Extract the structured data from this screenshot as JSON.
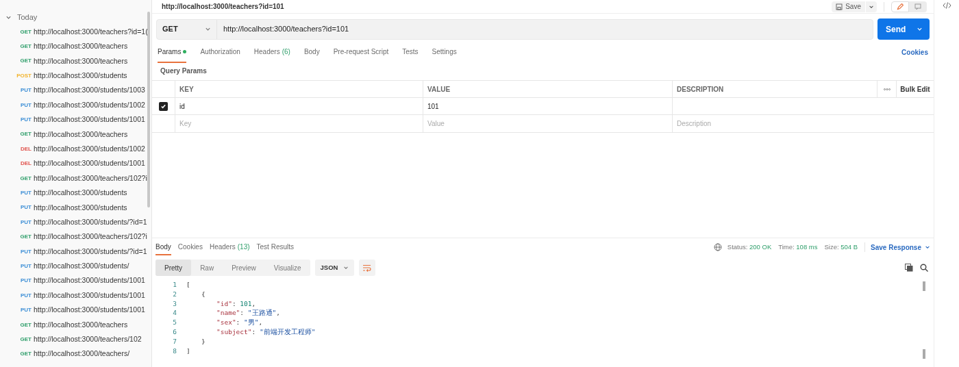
{
  "sidebar": {
    "group": {
      "label": "Today",
      "expanded": true
    },
    "items": [
      {
        "method": "GET",
        "color": "#2e9e6a",
        "url": "http://localhost:3000/teachers?id=1("
      },
      {
        "method": "GET",
        "color": "#2e9e6a",
        "url": "http://localhost:3000/teachers"
      },
      {
        "method": "GET",
        "color": "#2e9e6a",
        "url": "http://localhost:3000/teachers"
      },
      {
        "method": "POST",
        "color": "#f2b32b",
        "url": "http://localhost:3000/students"
      },
      {
        "method": "PUT",
        "color": "#3d8fd6",
        "url": "http://localhost:3000/students/1003"
      },
      {
        "method": "PUT",
        "color": "#3d8fd6",
        "url": "http://localhost:3000/students/1002"
      },
      {
        "method": "PUT",
        "color": "#3d8fd6",
        "url": "http://localhost:3000/students/1001"
      },
      {
        "method": "GET",
        "color": "#2e9e6a",
        "url": "http://localhost:3000/teachers"
      },
      {
        "method": "DEL",
        "color": "#e0524c",
        "url": "http://localhost:3000/students/1002"
      },
      {
        "method": "DEL",
        "color": "#e0524c",
        "url": "http://localhost:3000/students/1001"
      },
      {
        "method": "GET",
        "color": "#2e9e6a",
        "url": "http://localhost:3000/teachers/102?i"
      },
      {
        "method": "PUT",
        "color": "#3d8fd6",
        "url": "http://localhost:3000/students"
      },
      {
        "method": "PUT",
        "color": "#3d8fd6",
        "url": "http://localhost:3000/students"
      },
      {
        "method": "PUT",
        "color": "#3d8fd6",
        "url": "http://localhost:3000/students/?id=1"
      },
      {
        "method": "GET",
        "color": "#2e9e6a",
        "url": "http://localhost:3000/teachers/102?i"
      },
      {
        "method": "PUT",
        "color": "#3d8fd6",
        "url": "http://localhost:3000/students/?id=1"
      },
      {
        "method": "PUT",
        "color": "#3d8fd6",
        "url": "http://localhost:3000/students/"
      },
      {
        "method": "PUT",
        "color": "#3d8fd6",
        "url": "http://localhost:3000/students/1001"
      },
      {
        "method": "PUT",
        "color": "#3d8fd6",
        "url": "http://localhost:3000/students/1001"
      },
      {
        "method": "PUT",
        "color": "#3d8fd6",
        "url": "http://localhost:3000/students/1001"
      },
      {
        "method": "GET",
        "color": "#2e9e6a",
        "url": "http://localhost:3000/teachers"
      },
      {
        "method": "GET",
        "color": "#2e9e6a",
        "url": "http://localhost:3000/teachers/102"
      },
      {
        "method": "GET",
        "color": "#2e9e6a",
        "url": "http://localhost:3000/teachers/"
      }
    ]
  },
  "request": {
    "title": "http://localhost:3000/teachers?id=101",
    "save": "Save",
    "method": "GET",
    "url": "http://localhost:3000/teachers?id=101",
    "send": "Send",
    "tabs": [
      {
        "label": "Params",
        "dot": true,
        "selected": true
      },
      {
        "label": "Authorization",
        "dot": false,
        "selected": false
      },
      {
        "label": "Headers",
        "count": "(6)",
        "dot": false,
        "selected": false
      },
      {
        "label": "Body",
        "dot": false,
        "selected": false
      },
      {
        "label": "Pre-request Script",
        "dot": false,
        "selected": false
      },
      {
        "label": "Tests",
        "dot": false,
        "selected": false
      },
      {
        "label": "Settings",
        "dot": false,
        "selected": false
      }
    ],
    "cookies": "Cookies",
    "section": "Query Params",
    "columns": [
      "KEY",
      "VALUE",
      "DESCRIPTION"
    ],
    "bulk_edit": "Bulk Edit",
    "rows": [
      {
        "checked": true,
        "key": "id",
        "value": "101"
      }
    ],
    "new_row": {
      "key_placeholder": "Key",
      "value_placeholder": "Value",
      "description_placeholder": "Description"
    }
  },
  "response": {
    "tabs": [
      {
        "label": "Body",
        "selected": true
      },
      {
        "label": "Cookies",
        "selected": false
      },
      {
        "label": "Headers",
        "count": "(13)",
        "selected": false
      },
      {
        "label": "Test Results",
        "selected": false
      }
    ],
    "status": [
      {
        "label": "Status:",
        "value": "200 OK"
      },
      {
        "label": "Time:",
        "value": "108 ms"
      },
      {
        "label": "Size:",
        "value": "504 B"
      }
    ],
    "save_response": "Save Response",
    "views": [
      {
        "label": "Pretty",
        "selected": true
      },
      {
        "label": "Raw",
        "selected": false
      },
      {
        "label": "Preview",
        "selected": false
      },
      {
        "label": "Visualize",
        "selected": false
      }
    ],
    "format": "JSON",
    "lines": [
      {
        "number": "1",
        "tokens": [
          {
            "kind": "punct",
            "text": "["
          }
        ],
        "children": [
          {
            "number": "2",
            "tokens": [
              {
                "kind": "punct",
                "text": "{"
              }
            ],
            "children": [
              {
                "number": "3",
                "tokens": [
                  {
                    "kind": "key",
                    "text": "\"id\""
                  },
                  {
                    "kind": "punct",
                    "text": ": "
                  },
                  {
                    "kind": "number",
                    "text": "101"
                  },
                  {
                    "kind": "punct",
                    "text": ","
                  }
                ]
              },
              {
                "number": "4",
                "tokens": [
                  {
                    "kind": "key",
                    "text": "\"name\""
                  },
                  {
                    "kind": "punct",
                    "text": ": "
                  },
                  {
                    "kind": "string",
                    "text": "\"王路通\""
                  },
                  {
                    "kind": "punct",
                    "text": ","
                  }
                ]
              },
              {
                "number": "5",
                "tokens": [
                  {
                    "kind": "key",
                    "text": "\"sex\""
                  },
                  {
                    "kind": "punct",
                    "text": ": "
                  },
                  {
                    "kind": "string",
                    "text": "\"男\""
                  },
                  {
                    "kind": "punct",
                    "text": ","
                  }
                ]
              },
              {
                "number": "6",
                "tokens": [
                  {
                    "kind": "key",
                    "text": "\"subject\""
                  },
                  {
                    "kind": "punct",
                    "text": ": "
                  },
                  {
                    "kind": "string",
                    "text": "\"前端开发工程师\""
                  }
                ]
              }
            ]
          },
          {
            "number": "7",
            "tokens": [
              {
                "kind": "punct",
                "text": "}"
              }
            ]
          }
        ]
      },
      {
        "number": "8",
        "tokens": [
          {
            "kind": "punct",
            "text": "]"
          }
        ]
      }
    ]
  }
}
